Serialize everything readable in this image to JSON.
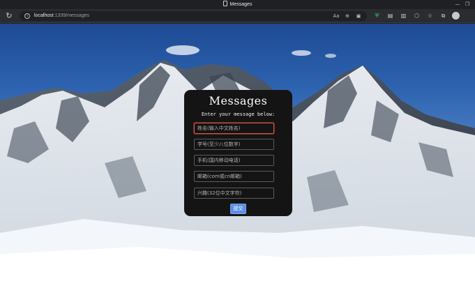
{
  "browser": {
    "tab_title": "Messages",
    "url_host": "localhost",
    "url_rest": ":1339/messages",
    "minimize_glyph": "—",
    "restore_glyph": "❐"
  },
  "form": {
    "title": "Messages",
    "subtitle": "Enter your message below:",
    "fields": [
      {
        "placeholder": "姓名(输入中文姓名)"
      },
      {
        "placeholder": "学号(至少八位数字)"
      },
      {
        "placeholder": "手机(国内移动电话)"
      },
      {
        "placeholder": "邮箱(com或cn邮箱)"
      },
      {
        "placeholder": "兴趣(32位中文字符)"
      }
    ],
    "submit_label": "提交",
    "colors": {
      "card": "#141414",
      "submit": "#5b8ee6",
      "focus_border": "#d9534f"
    }
  }
}
